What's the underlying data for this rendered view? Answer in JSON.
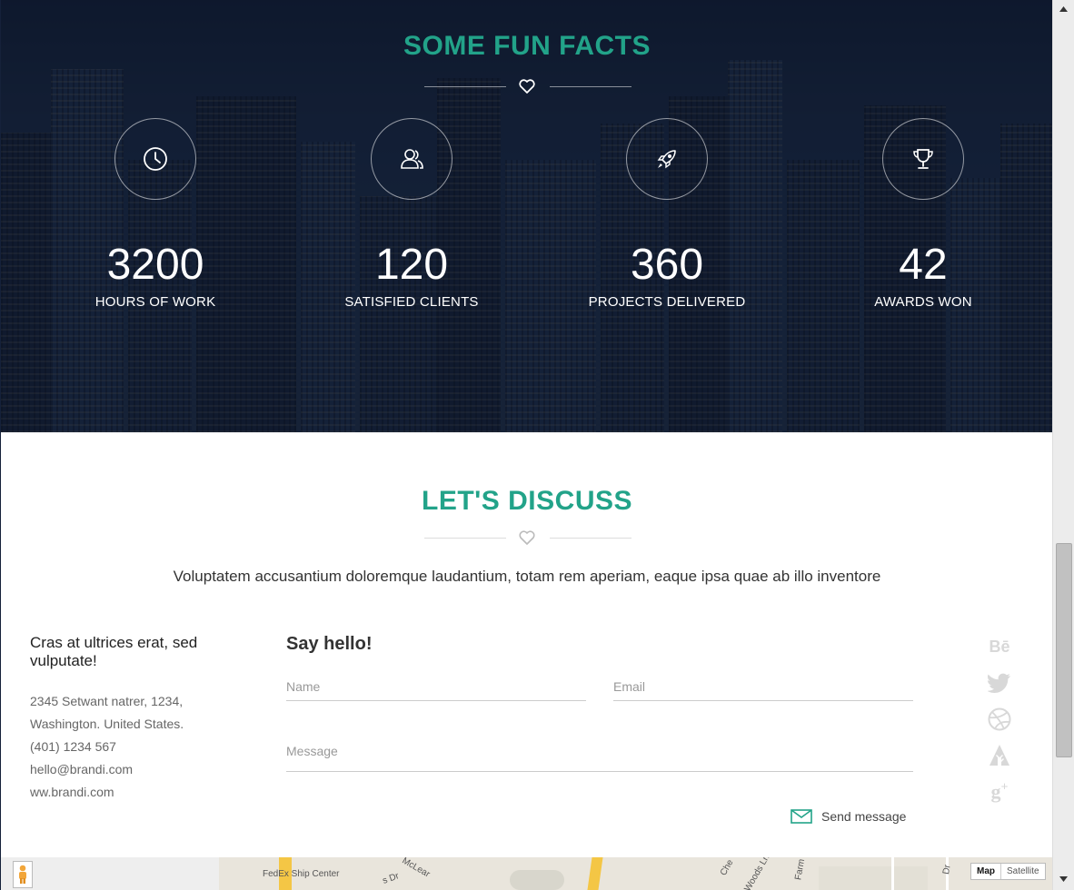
{
  "facts": {
    "title": "SOME FUN FACTS",
    "items": [
      {
        "icon": "clock-icon",
        "number": "3200",
        "label": "HOURS OF WORK"
      },
      {
        "icon": "users-icon",
        "number": "120",
        "label": "SATISFIED CLIENTS"
      },
      {
        "icon": "rocket-icon",
        "number": "360",
        "label": "PROJECTS DELIVERED"
      },
      {
        "icon": "trophy-icon",
        "number": "42",
        "label": "AWARDS WON"
      }
    ]
  },
  "discuss": {
    "title": "LET'S DISCUSS",
    "intro": "Voluptatem accusantium doloremque laudantium, totam rem aperiam, eaque ipsa quae ab illo inventore",
    "contact": {
      "heading": "Cras at ultrices erat, sed vulputate!",
      "lines": [
        "2345 Setwant natrer, 1234,",
        "Washington. United States.",
        "(401) 1234 567",
        "hello@brandi.com",
        "ww.brandi.com"
      ]
    },
    "form": {
      "title": "Say hello!",
      "name_placeholder": "Name",
      "email_placeholder": "Email",
      "message_placeholder": "Message",
      "send_label": "Send message"
    },
    "social": [
      "behance-icon",
      "twitter-icon",
      "dribbble-icon",
      "forrst-icon",
      "google-plus-icon"
    ]
  },
  "map": {
    "labels": [
      "FedEx Ship Center",
      "McLear",
      "s Dr",
      "Che",
      "Woods Ln",
      "Farm",
      "Dr"
    ],
    "type_map": "Map",
    "type_satellite": "Satellite"
  },
  "colors": {
    "accent": "#22a389",
    "text": "#333333",
    "muted": "#999999"
  }
}
